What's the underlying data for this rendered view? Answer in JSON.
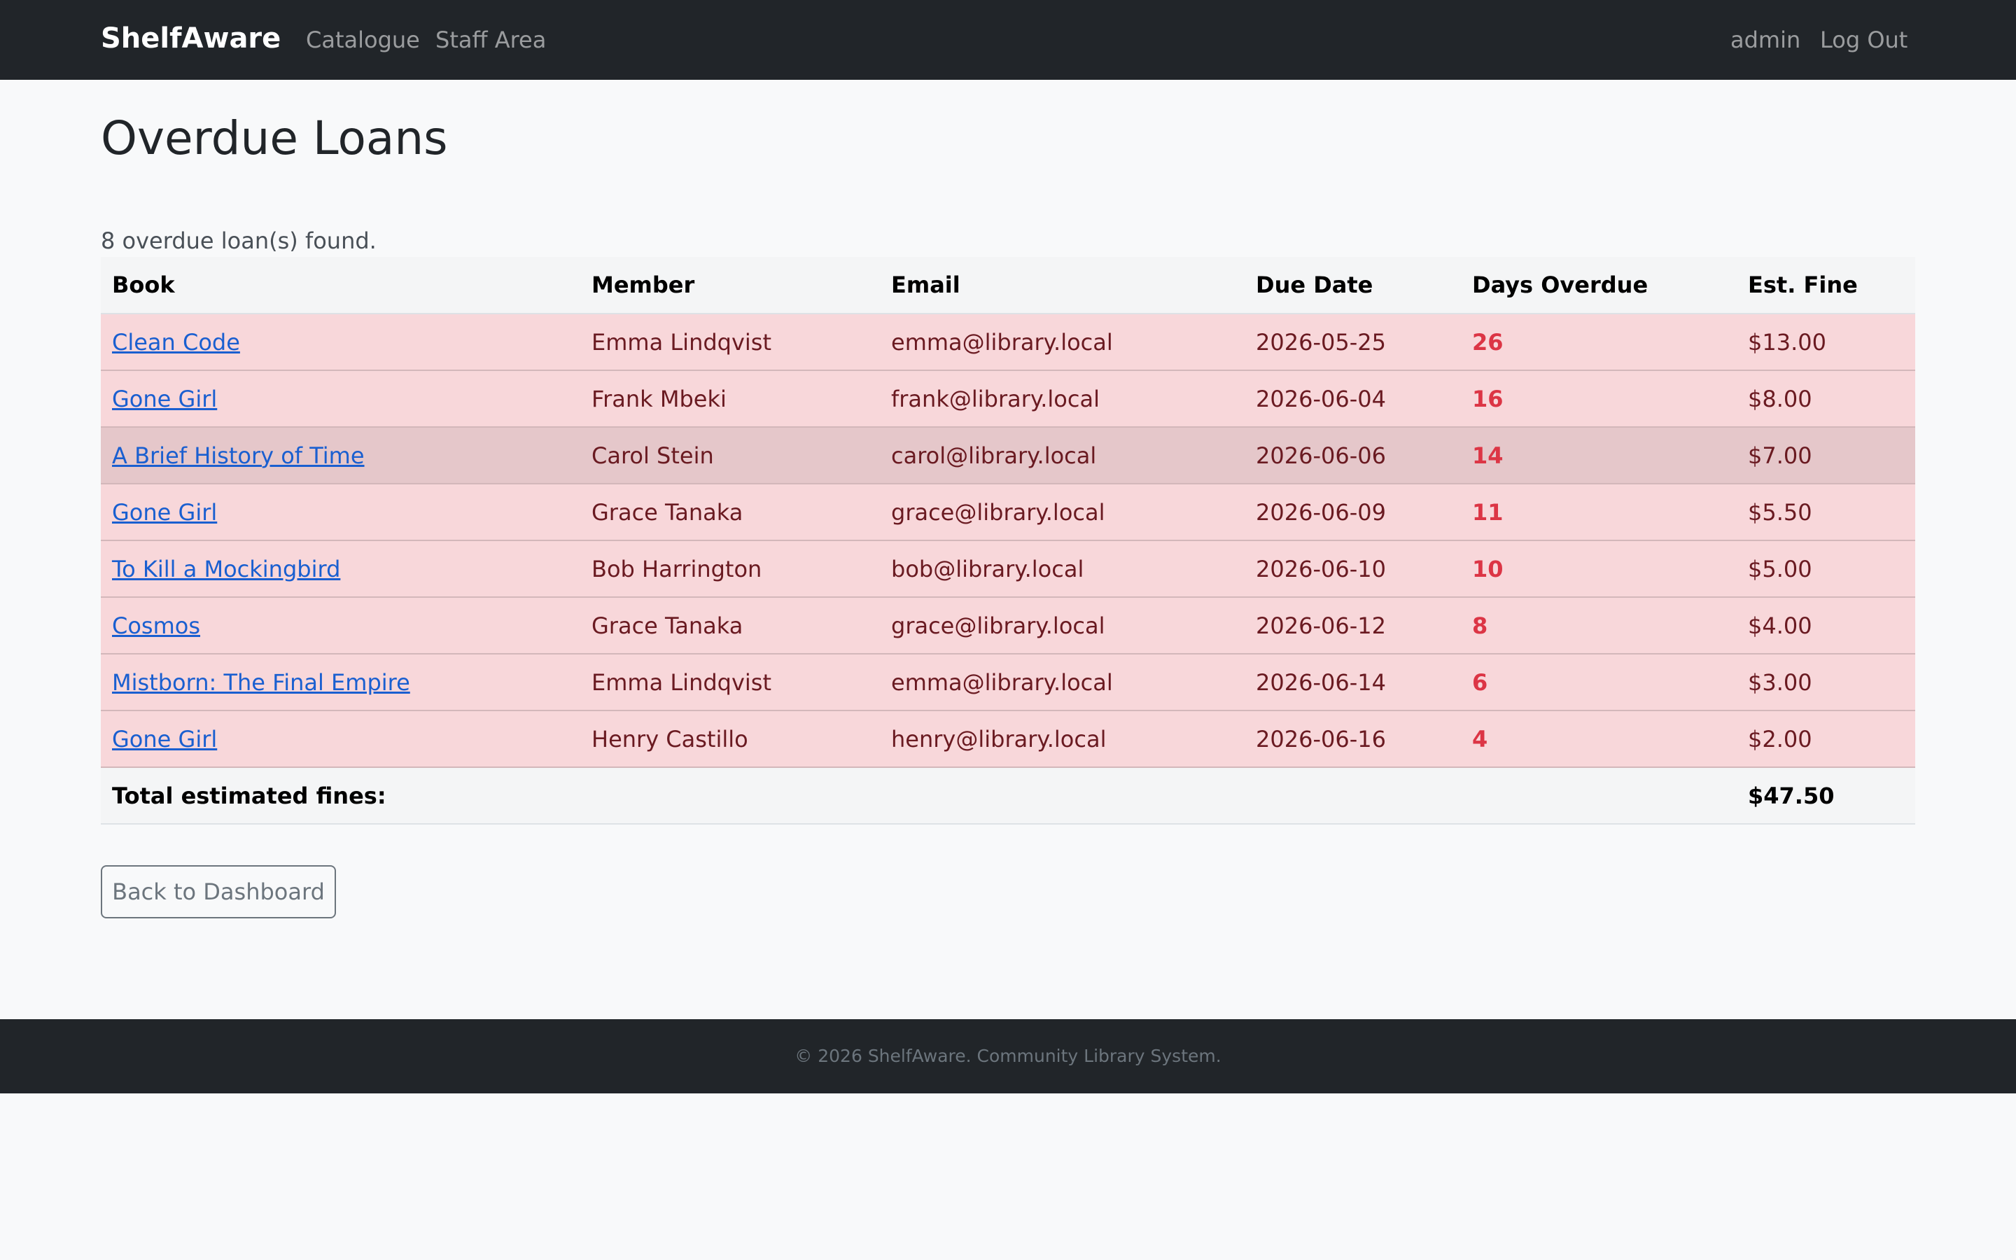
{
  "navbar": {
    "brand": "ShelfAware",
    "links": [
      "Catalogue",
      "Staff Area"
    ],
    "user": "admin",
    "logout": "Log Out"
  },
  "page": {
    "title": "Overdue Loans",
    "summary": "8 overdue loan(s) found."
  },
  "table": {
    "headers": [
      "Book",
      "Member",
      "Email",
      "Due Date",
      "Days Overdue",
      "Est. Fine"
    ],
    "rows": [
      {
        "book": "Clean Code",
        "member": "Emma Lindqvist",
        "email": "emma@library.local",
        "due": "2026-05-25",
        "days": "26",
        "fine": "$13.00"
      },
      {
        "book": "Gone Girl",
        "member": "Frank Mbeki",
        "email": "frank@library.local",
        "due": "2026-06-04",
        "days": "16",
        "fine": "$8.00"
      },
      {
        "book": "A Brief History of Time",
        "member": "Carol Stein",
        "email": "carol@library.local",
        "due": "2026-06-06",
        "days": "14",
        "fine": "$7.00"
      },
      {
        "book": "Gone Girl",
        "member": "Grace Tanaka",
        "email": "grace@library.local",
        "due": "2026-06-09",
        "days": "11",
        "fine": "$5.50"
      },
      {
        "book": "To Kill a Mockingbird",
        "member": "Bob Harrington",
        "email": "bob@library.local",
        "due": "2026-06-10",
        "days": "10",
        "fine": "$5.00"
      },
      {
        "book": "Cosmos",
        "member": "Grace Tanaka",
        "email": "grace@library.local",
        "due": "2026-06-12",
        "days": "8",
        "fine": "$4.00"
      },
      {
        "book": "Mistborn: The Final Empire",
        "member": "Emma Lindqvist",
        "email": "emma@library.local",
        "due": "2026-06-14",
        "days": "6",
        "fine": "$3.00"
      },
      {
        "book": "Gone Girl",
        "member": "Henry Castillo",
        "email": "henry@library.local",
        "due": "2026-06-16",
        "days": "4",
        "fine": "$2.00"
      }
    ],
    "total_label": "Total estimated fines:",
    "total_value": "$47.50"
  },
  "actions": {
    "back": "Back to Dashboard"
  },
  "footer": {
    "text": "© 2026 ShelfAware. Community Library System."
  },
  "colors": {
    "navbar_bg": "#212529",
    "row_danger_bg": "#f8d7da",
    "row_hover_bg": "#e5c7ca",
    "days_overdue_text": "#dc3545",
    "link": "#1a5fd0"
  }
}
